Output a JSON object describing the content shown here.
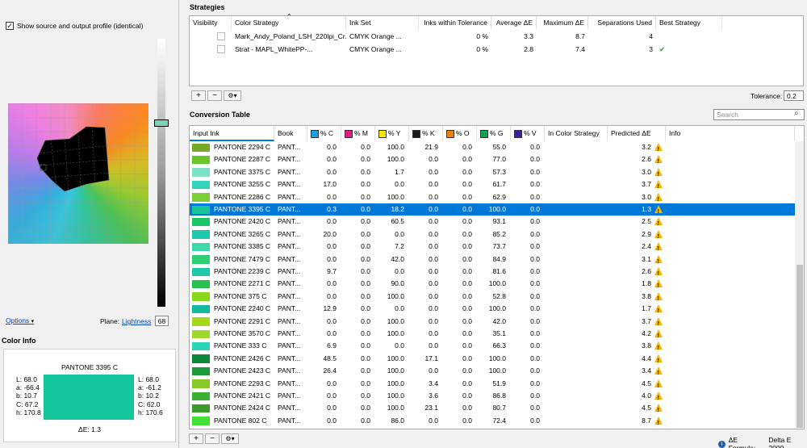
{
  "left": {
    "show_profile_label": "Show source and output profile (identical)",
    "options_label": "Options",
    "plane_label": "Plane:",
    "plane_value": "Lightness",
    "lightness_value": "68",
    "color_info_title": "Color Info",
    "color_info": {
      "name": "PANTONE 3395 C",
      "swatch_color": "#14c49a",
      "left": [
        "L: 68.0",
        "a: -66.4",
        "b: 10.7",
        "C: 67.2",
        "h: 170.8"
      ],
      "right": [
        "L: 68.0",
        "a: -61.2",
        "b: 10.2",
        "C: 62.0",
        "h: 170.6"
      ],
      "delta": "ΔE: 1.3"
    }
  },
  "strategies": {
    "title": "Strategies",
    "headers": [
      "Visibility",
      "Color Strategy",
      "Ink Set",
      "Inks within Tolerance",
      "Average ΔE",
      "Maximum ΔE",
      "Separations Used",
      "Best Strategy"
    ],
    "rows": [
      {
        "strategy": "Mark_Andy_Poland_LSH_220lpi_Cr...",
        "inkset": "CMYK Orange ...",
        "within": "0 %",
        "avg": "3.3",
        "max": "8.7",
        "seps": "4",
        "best": ""
      },
      {
        "strategy": "Strat - MAPL_WhitePP-...",
        "inkset": "CMYK Orange ...",
        "within": "0 %",
        "avg": "2.8",
        "max": "7.4",
        "seps": "3",
        "best": "✔"
      }
    ],
    "tolerance_label": "Tolerance:",
    "tolerance_value": "0.2"
  },
  "buttons": {
    "add": "+",
    "remove": "−",
    "gear": "⚙▾"
  },
  "conversion": {
    "title": "Conversion Table",
    "search_placeholder": "Search",
    "headers": {
      "input_ink": "Input Ink",
      "book": "Book",
      "c": "%  C",
      "m": "%  M",
      "y": "%  Y",
      "k": "%  K",
      "o": "%  O",
      "g": "%  G",
      "v": "%  V",
      "in_strategy": "In Color Strategy",
      "predicted": "Predicted ΔE",
      "info": "Info"
    },
    "ink_colors": {
      "c": "#1aa0e0",
      "m": "#e0198c",
      "y": "#f5e600",
      "k": "#1a1a1a",
      "o": "#f07d14",
      "g": "#0fa050",
      "v": "#3b1fa0"
    },
    "rows": [
      {
        "name": "PANTONE 2294 C",
        "book": "PANT...",
        "c": "0.0",
        "m": "0.0",
        "y": "100.0",
        "k": "21.9",
        "o": "0.0",
        "g": "55.0",
        "v": "0.0",
        "de": "3.2",
        "sw": "#74a928"
      },
      {
        "name": "PANTONE 2287 C",
        "book": "PANT...",
        "c": "0.0",
        "m": "0.0",
        "y": "100.0",
        "k": "0.0",
        "o": "0.0",
        "g": "77.0",
        "v": "0.0",
        "de": "2.6",
        "sw": "#6cc42c"
      },
      {
        "name": "PANTONE 3375 C",
        "book": "PANT...",
        "c": "0.0",
        "m": "0.0",
        "y": "1.7",
        "k": "0.0",
        "o": "0.0",
        "g": "57.3",
        "v": "0.0",
        "de": "3.0",
        "sw": "#7ee0c4"
      },
      {
        "name": "PANTONE 3255 C",
        "book": "PANT...",
        "c": "17.0",
        "m": "0.0",
        "y": "0.0",
        "k": "0.0",
        "o": "0.0",
        "g": "61.7",
        "v": "0.0",
        "de": "3.7",
        "sw": "#32d2bd"
      },
      {
        "name": "PANTONE 2286 C",
        "book": "PANT...",
        "c": "0.0",
        "m": "0.0",
        "y": "100.0",
        "k": "0.0",
        "o": "0.0",
        "g": "62.9",
        "v": "0.0",
        "de": "3.0",
        "sw": "#7ccf34"
      },
      {
        "name": "PANTONE 3395 C",
        "book": "PANT...",
        "c": "0.3",
        "m": "0.0",
        "y": "18.2",
        "k": "0.0",
        "o": "0.0",
        "g": "100.0",
        "v": "0.0",
        "de": "1.3",
        "sw": "#14c49a",
        "selected": true
      },
      {
        "name": "PANTONE 2420 C",
        "book": "PANT...",
        "c": "0.0",
        "m": "0.0",
        "y": "60.5",
        "k": "0.0",
        "o": "0.0",
        "g": "93.1",
        "v": "0.0",
        "de": "2.5",
        "sw": "#1cc46a"
      },
      {
        "name": "PANTONE 3265 C",
        "book": "PANT...",
        "c": "20.0",
        "m": "0.0",
        "y": "0.0",
        "k": "0.0",
        "o": "0.0",
        "g": "85.2",
        "v": "0.0",
        "de": "2.9",
        "sw": "#1ec8b0"
      },
      {
        "name": "PANTONE 3385 C",
        "book": "PANT...",
        "c": "0.0",
        "m": "0.0",
        "y": "7.2",
        "k": "0.0",
        "o": "0.0",
        "g": "73.7",
        "v": "0.0",
        "de": "2.4",
        "sw": "#3fd8aa"
      },
      {
        "name": "PANTONE 7479 C",
        "book": "PANT...",
        "c": "0.0",
        "m": "0.0",
        "y": "42.0",
        "k": "0.0",
        "o": "0.0",
        "g": "84.9",
        "v": "0.0",
        "de": "3.1",
        "sw": "#2ccf72"
      },
      {
        "name": "PANTONE 2239 C",
        "book": "PANT...",
        "c": "9.7",
        "m": "0.0",
        "y": "0.0",
        "k": "0.0",
        "o": "0.0",
        "g": "81.6",
        "v": "0.0",
        "de": "2.6",
        "sw": "#1ec7a8"
      },
      {
        "name": "PANTONE 2271 C",
        "book": "PANT...",
        "c": "0.0",
        "m": "0.0",
        "y": "90.0",
        "k": "0.0",
        "o": "0.0",
        "g": "100.0",
        "v": "0.0",
        "de": "1.8",
        "sw": "#28c050"
      },
      {
        "name": "PANTONE 375 C",
        "book": "PANT...",
        "c": "0.0",
        "m": "0.0",
        "y": "100.0",
        "k": "0.0",
        "o": "0.0",
        "g": "52.8",
        "v": "0.0",
        "de": "3.8",
        "sw": "#8ad61c"
      },
      {
        "name": "PANTONE 2240 C",
        "book": "PANT...",
        "c": "12.9",
        "m": "0.0",
        "y": "0.0",
        "k": "0.0",
        "o": "0.0",
        "g": "100.0",
        "v": "0.0",
        "de": "1.7",
        "sw": "#12b8a0"
      },
      {
        "name": "PANTONE 2291 C",
        "book": "PANT...",
        "c": "0.0",
        "m": "0.0",
        "y": "100.0",
        "k": "0.0",
        "o": "0.0",
        "g": "42.0",
        "v": "0.0",
        "de": "3.7",
        "sw": "#a6d81c"
      },
      {
        "name": "PANTONE 3570 C",
        "book": "PANT...",
        "c": "0.0",
        "m": "0.0",
        "y": "100.0",
        "k": "0.0",
        "o": "0.0",
        "g": "35.1",
        "v": "0.0",
        "de": "4.2",
        "sw": "#9ed82a"
      },
      {
        "name": "PANTONE 333 C",
        "book": "PANT...",
        "c": "6.9",
        "m": "0.0",
        "y": "0.0",
        "k": "0.0",
        "o": "0.0",
        "g": "66.3",
        "v": "0.0",
        "de": "3.8",
        "sw": "#2ad4b4"
      },
      {
        "name": "PANTONE 2426 C",
        "book": "PANT...",
        "c": "48.5",
        "m": "0.0",
        "y": "100.0",
        "k": "17.1",
        "o": "0.0",
        "g": "100.0",
        "v": "0.0",
        "de": "4.4",
        "sw": "#10883a"
      },
      {
        "name": "PANTONE 2423 C",
        "book": "PANT...",
        "c": "26.4",
        "m": "0.0",
        "y": "100.0",
        "k": "0.0",
        "o": "0.0",
        "g": "100.0",
        "v": "0.0",
        "de": "3.4",
        "sw": "#1a9a3a"
      },
      {
        "name": "PANTONE 2293 C",
        "book": "PANT...",
        "c": "0.0",
        "m": "0.0",
        "y": "100.0",
        "k": "3.4",
        "o": "0.0",
        "g": "51.9",
        "v": "0.0",
        "de": "4.5",
        "sw": "#88c828"
      },
      {
        "name": "PANTONE 2421 C",
        "book": "PANT...",
        "c": "0.0",
        "m": "0.0",
        "y": "100.0",
        "k": "3.6",
        "o": "0.0",
        "g": "86.8",
        "v": "0.0",
        "de": "4.0",
        "sw": "#3cb034"
      },
      {
        "name": "PANTONE 2424 C",
        "book": "PANT...",
        "c": "0.0",
        "m": "0.0",
        "y": "100.0",
        "k": "23.1",
        "o": "0.0",
        "g": "80.7",
        "v": "0.0",
        "de": "4.5",
        "sw": "#3a9a2a"
      },
      {
        "name": "PANTONE 802 C",
        "book": "PANT...",
        "c": "0.0",
        "m": "0.0",
        "y": "86.0",
        "k": "0.0",
        "o": "0.0",
        "g": "72.4",
        "v": "0.0",
        "de": "8.7",
        "sw": "#44e03a"
      }
    ]
  },
  "footer": {
    "formula_label": "ΔE Formula:",
    "formula_value": "Delta E 2000"
  }
}
